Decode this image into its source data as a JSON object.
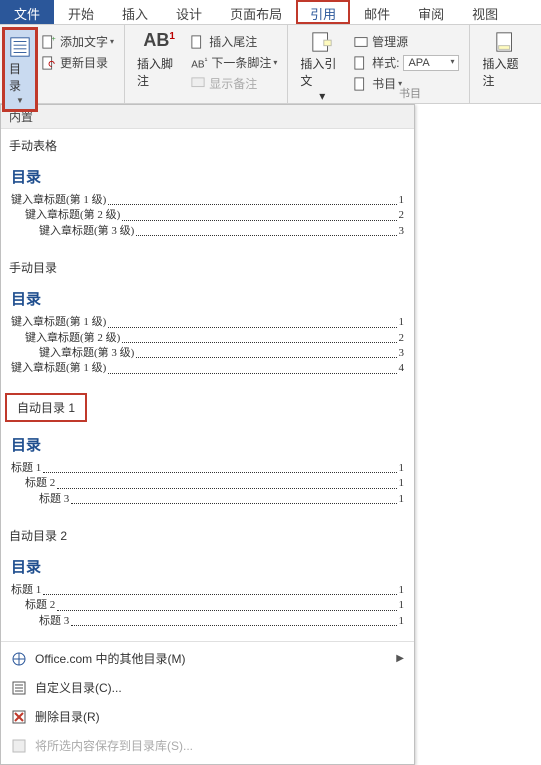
{
  "tabs": {
    "file": "文件",
    "home": "开始",
    "insert": "插入",
    "design": "设计",
    "layout": "页面布局",
    "references": "引用",
    "mail": "邮件",
    "review": "审阅",
    "view": "视图"
  },
  "ribbon": {
    "toc_label": "目录",
    "add_text": "添加文字",
    "update_toc": "更新目录",
    "insert_footnote": "插入脚注",
    "insert_footnote_label_big": "AB",
    "insert_endnote": "插入尾注",
    "next_footnote": "下一条脚注",
    "show_notes": "显示备注",
    "insert_citation": "插入引文",
    "manage_sources": "管理源",
    "style_label": "样式:",
    "style_value": "APA",
    "bibliography": "书目",
    "insert_caption": "插入题注",
    "right_extra": "书目"
  },
  "panel": {
    "builtin": "内置",
    "sections": {
      "manual_table": "手动表格",
      "manual_toc": "手动目录",
      "auto_toc1": "自动目录 1",
      "auto_toc2": "自动目录 2"
    },
    "preview_title": "目录",
    "manual_lines": [
      {
        "label": "键入章标题(第 1 级)",
        "page": "1",
        "indent": 0
      },
      {
        "label": "键入章标题(第 2 级)",
        "page": "2",
        "indent": 1
      },
      {
        "label": "键入章标题(第 3 级)",
        "page": "3",
        "indent": 2
      }
    ],
    "manual_toc_lines": [
      {
        "label": "键入章标题(第 1 级)",
        "page": "1",
        "indent": 0
      },
      {
        "label": "键入章标题(第 2 级)",
        "page": "2",
        "indent": 1
      },
      {
        "label": "键入章标题(第 3 级)",
        "page": "3",
        "indent": 2
      },
      {
        "label": "键入章标题(第 1 级)",
        "page": "4",
        "indent": 0
      }
    ],
    "auto_lines": [
      {
        "label": "标题 1",
        "page": "1",
        "indent": 0
      },
      {
        "label": "标题 2",
        "page": "1",
        "indent": 1
      },
      {
        "label": "标题 3",
        "page": "1",
        "indent": 2
      }
    ],
    "menu": {
      "office_more": "Office.com 中的其他目录(M)",
      "custom": "自定义目录(C)...",
      "remove": "删除目录(R)",
      "save_selection": "将所选内容保存到目录库(S)..."
    }
  }
}
